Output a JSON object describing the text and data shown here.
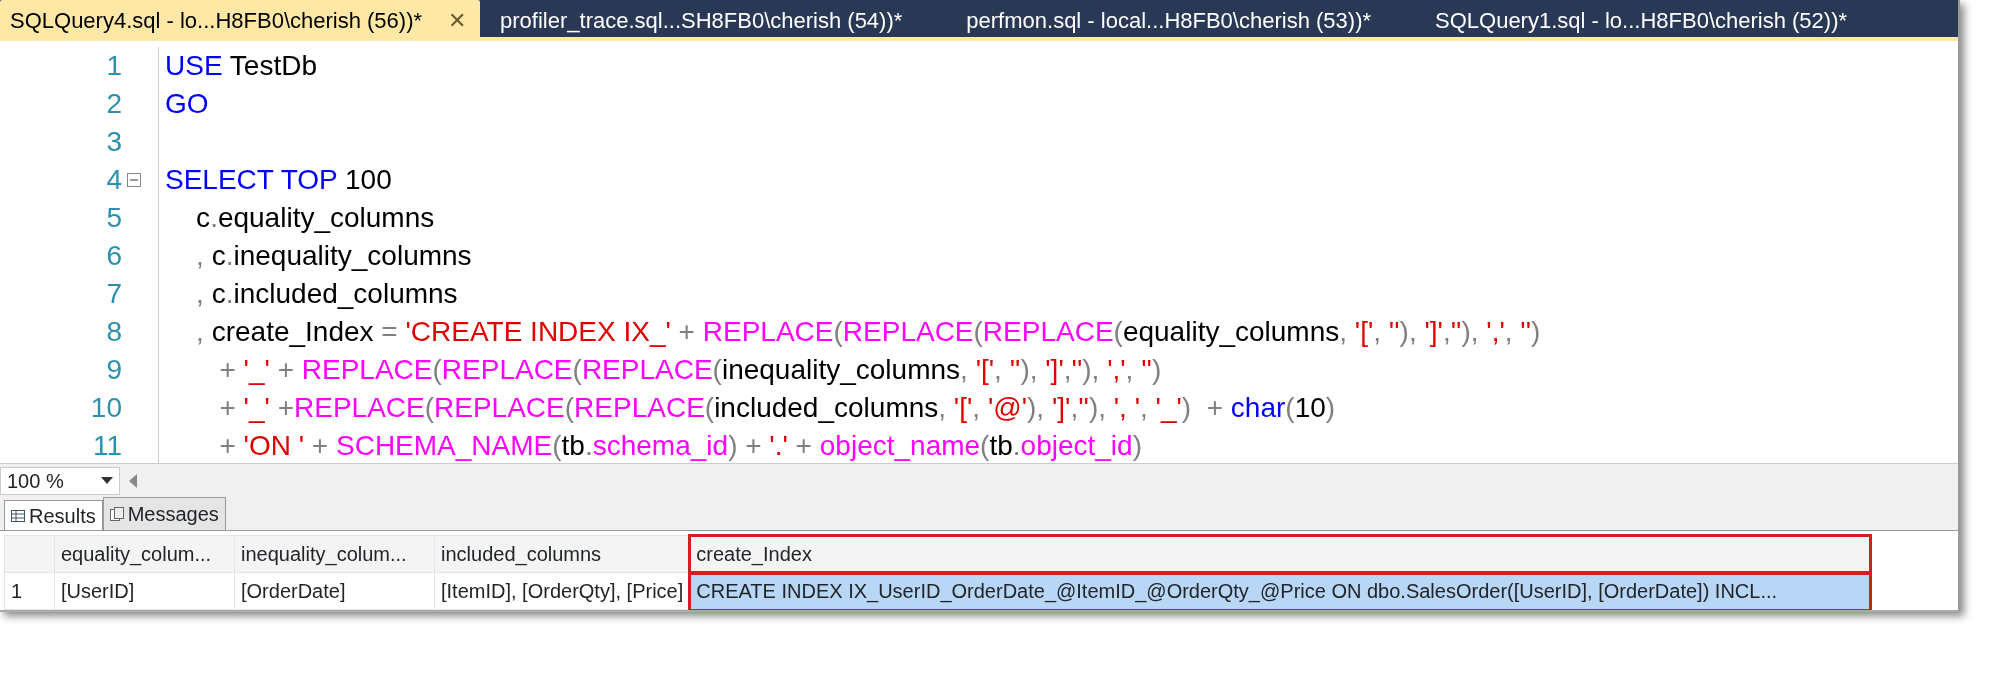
{
  "tabs": [
    {
      "label": "SQLQuery4.sql - lo...H8FB0\\cherish (56))*",
      "selected": true,
      "close": "✕"
    },
    {
      "label": "profiler_trace.sql...SH8FB0\\cherish (54))*",
      "selected": false
    },
    {
      "label": "perfmon.sql - local...H8FB0\\cherish (53))*",
      "selected": false
    },
    {
      "label": "SQLQuery1.sql - lo...H8FB0\\cherish (52))*",
      "selected": false
    }
  ],
  "editor": {
    "lines": [
      {
        "number": "1",
        "tokens": [
          {
            "kind": "keyword",
            "text": "USE"
          },
          {
            "kind": "plain",
            "text": " TestDb"
          }
        ]
      },
      {
        "number": "2",
        "tokens": [
          {
            "kind": "keyword",
            "text": "GO"
          }
        ]
      },
      {
        "number": "3"
      },
      {
        "number": "4",
        "expanded": true,
        "tokens": [
          {
            "kind": "keyword",
            "text": "SELECT TOP"
          },
          {
            "kind": "plain",
            "text": " 100"
          }
        ]
      },
      {
        "number": "5",
        "tokens": [
          {
            "kind": "plain",
            "text": "    c"
          },
          {
            "kind": "operator",
            "text": "."
          },
          {
            "kind": "plain",
            "text": "equality_columns"
          }
        ]
      },
      {
        "number": "6",
        "tokens": [
          {
            "kind": "operator",
            "text": "    ,"
          },
          {
            "kind": "plain",
            "text": " c"
          },
          {
            "kind": "operator",
            "text": "."
          },
          {
            "kind": "plain",
            "text": "inequality_columns"
          }
        ]
      },
      {
        "number": "7",
        "tokens": [
          {
            "kind": "operator",
            "text": "    ,"
          },
          {
            "kind": "plain",
            "text": " c"
          },
          {
            "kind": "operator",
            "text": "."
          },
          {
            "kind": "plain",
            "text": "included_columns"
          }
        ]
      },
      {
        "number": "8",
        "tokens": [
          {
            "kind": "operator",
            "text": "    ,"
          },
          {
            "kind": "plain",
            "text": " create_Index "
          },
          {
            "kind": "operator",
            "text": "="
          },
          {
            "kind": "string",
            "text": " 'CREATE INDEX IX_'"
          },
          {
            "kind": "operator",
            "text": " + "
          },
          {
            "kind": "function",
            "text": "REPLACE"
          },
          {
            "kind": "operator",
            "text": "("
          },
          {
            "kind": "function",
            "text": "REPLACE"
          },
          {
            "kind": "operator",
            "text": "("
          },
          {
            "kind": "function",
            "text": "REPLACE"
          },
          {
            "kind": "operator",
            "text": "("
          },
          {
            "kind": "plain",
            "text": "equality_columns"
          },
          {
            "kind": "operator",
            "text": ", "
          },
          {
            "kind": "string",
            "text": "'['"
          },
          {
            "kind": "operator",
            "text": ", "
          },
          {
            "kind": "string",
            "text": "''"
          },
          {
            "kind": "operator",
            "text": "), "
          },
          {
            "kind": "string",
            "text": "']'"
          },
          {
            "kind": "operator",
            "text": ","
          },
          {
            "kind": "string",
            "text": "''"
          },
          {
            "kind": "operator",
            "text": "), "
          },
          {
            "kind": "string",
            "text": "','"
          },
          {
            "kind": "operator",
            "text": ", "
          },
          {
            "kind": "string",
            "text": "''"
          },
          {
            "kind": "operator",
            "text": ")"
          }
        ]
      },
      {
        "number": "9",
        "tokens": [
          {
            "kind": "operator",
            "text": "       +"
          },
          {
            "kind": "string",
            "text": " '_'"
          },
          {
            "kind": "operator",
            "text": " + "
          },
          {
            "kind": "function",
            "text": "REPLACE"
          },
          {
            "kind": "operator",
            "text": "("
          },
          {
            "kind": "function",
            "text": "REPLACE"
          },
          {
            "kind": "operator",
            "text": "("
          },
          {
            "kind": "function",
            "text": "REPLACE"
          },
          {
            "kind": "operator",
            "text": "("
          },
          {
            "kind": "plain",
            "text": "inequality_columns"
          },
          {
            "kind": "operator",
            "text": ", "
          },
          {
            "kind": "string",
            "text": "'['"
          },
          {
            "kind": "operator",
            "text": ", "
          },
          {
            "kind": "string",
            "text": "''"
          },
          {
            "kind": "operator",
            "text": "), "
          },
          {
            "kind": "string",
            "text": "']'"
          },
          {
            "kind": "operator",
            "text": ","
          },
          {
            "kind": "string",
            "text": "''"
          },
          {
            "kind": "operator",
            "text": "), "
          },
          {
            "kind": "string",
            "text": "','"
          },
          {
            "kind": "operator",
            "text": ", "
          },
          {
            "kind": "string",
            "text": "''"
          },
          {
            "kind": "operator",
            "text": ")"
          }
        ]
      },
      {
        "number": "10",
        "tokens": [
          {
            "kind": "operator",
            "text": "       +"
          },
          {
            "kind": "string",
            "text": " '_'"
          },
          {
            "kind": "operator",
            "text": " +"
          },
          {
            "kind": "function",
            "text": "REPLACE"
          },
          {
            "kind": "operator",
            "text": "("
          },
          {
            "kind": "function",
            "text": "REPLACE"
          },
          {
            "kind": "operator",
            "text": "("
          },
          {
            "kind": "function",
            "text": "REPLACE"
          },
          {
            "kind": "operator",
            "text": "("
          },
          {
            "kind": "plain",
            "text": "included_columns"
          },
          {
            "kind": "operator",
            "text": ", "
          },
          {
            "kind": "string",
            "text": "'['"
          },
          {
            "kind": "operator",
            "text": ", "
          },
          {
            "kind": "string",
            "text": "'@'"
          },
          {
            "kind": "operator",
            "text": "), "
          },
          {
            "kind": "string",
            "text": "']'"
          },
          {
            "kind": "operator",
            "text": ","
          },
          {
            "kind": "string",
            "text": "''"
          },
          {
            "kind": "operator",
            "text": "), "
          },
          {
            "kind": "string",
            "text": "', '"
          },
          {
            "kind": "operator",
            "text": ", "
          },
          {
            "kind": "string",
            "text": "'_'"
          },
          {
            "kind": "operator",
            "text": ")  + "
          },
          {
            "kind": "keyword",
            "text": "char"
          },
          {
            "kind": "operator",
            "text": "("
          },
          {
            "kind": "plain",
            "text": "10"
          },
          {
            "kind": "operator",
            "text": ")"
          }
        ]
      },
      {
        "number": "11",
        "tokens": [
          {
            "kind": "operator",
            "text": "       +"
          },
          {
            "kind": "string",
            "text": " 'ON '"
          },
          {
            "kind": "operator",
            "text": " + "
          },
          {
            "kind": "function",
            "text": "SCHEMA_NAME"
          },
          {
            "kind": "operator",
            "text": "("
          },
          {
            "kind": "plain",
            "text": "tb"
          },
          {
            "kind": "operator",
            "text": "."
          },
          {
            "kind": "function",
            "text": "schema_id"
          },
          {
            "kind": "operator",
            "text": ") + "
          },
          {
            "kind": "string",
            "text": "'.'"
          },
          {
            "kind": "operator",
            "text": " + "
          },
          {
            "kind": "function",
            "text": "object_name"
          },
          {
            "kind": "operator",
            "text": "("
          },
          {
            "kind": "plain",
            "text": "tb"
          },
          {
            "kind": "operator",
            "text": "."
          },
          {
            "kind": "function",
            "text": "object_id"
          },
          {
            "kind": "operator",
            "text": ")"
          }
        ]
      }
    ]
  },
  "zoom": "100 %",
  "result_tabs": [
    {
      "label": "Results",
      "selected": true
    },
    {
      "label": "Messages",
      "selected": false
    }
  ],
  "grid": {
    "columns": [
      {
        "label": "equality_colum...",
        "highlighted": false
      },
      {
        "label": "inequality_colum...",
        "highlighted": false
      },
      {
        "label": "included_columns",
        "highlighted": false
      },
      {
        "label": "create_Index",
        "highlighted": true
      }
    ],
    "rows": [
      {
        "number": "1",
        "cells": [
          {
            "text": "[UserID]",
            "selected": false
          },
          {
            "text": "[OrderDate]",
            "selected": false
          },
          {
            "text": "[ItemID], [OrderQty], [Price]",
            "selected": false
          },
          {
            "text": "CREATE INDEX IX_UserID_OrderDate_@ItemID_@OrderQty_@Price ON dbo.SalesOrder([UserID], [OrderDate]) INCL...",
            "selected": true
          }
        ]
      }
    ]
  }
}
